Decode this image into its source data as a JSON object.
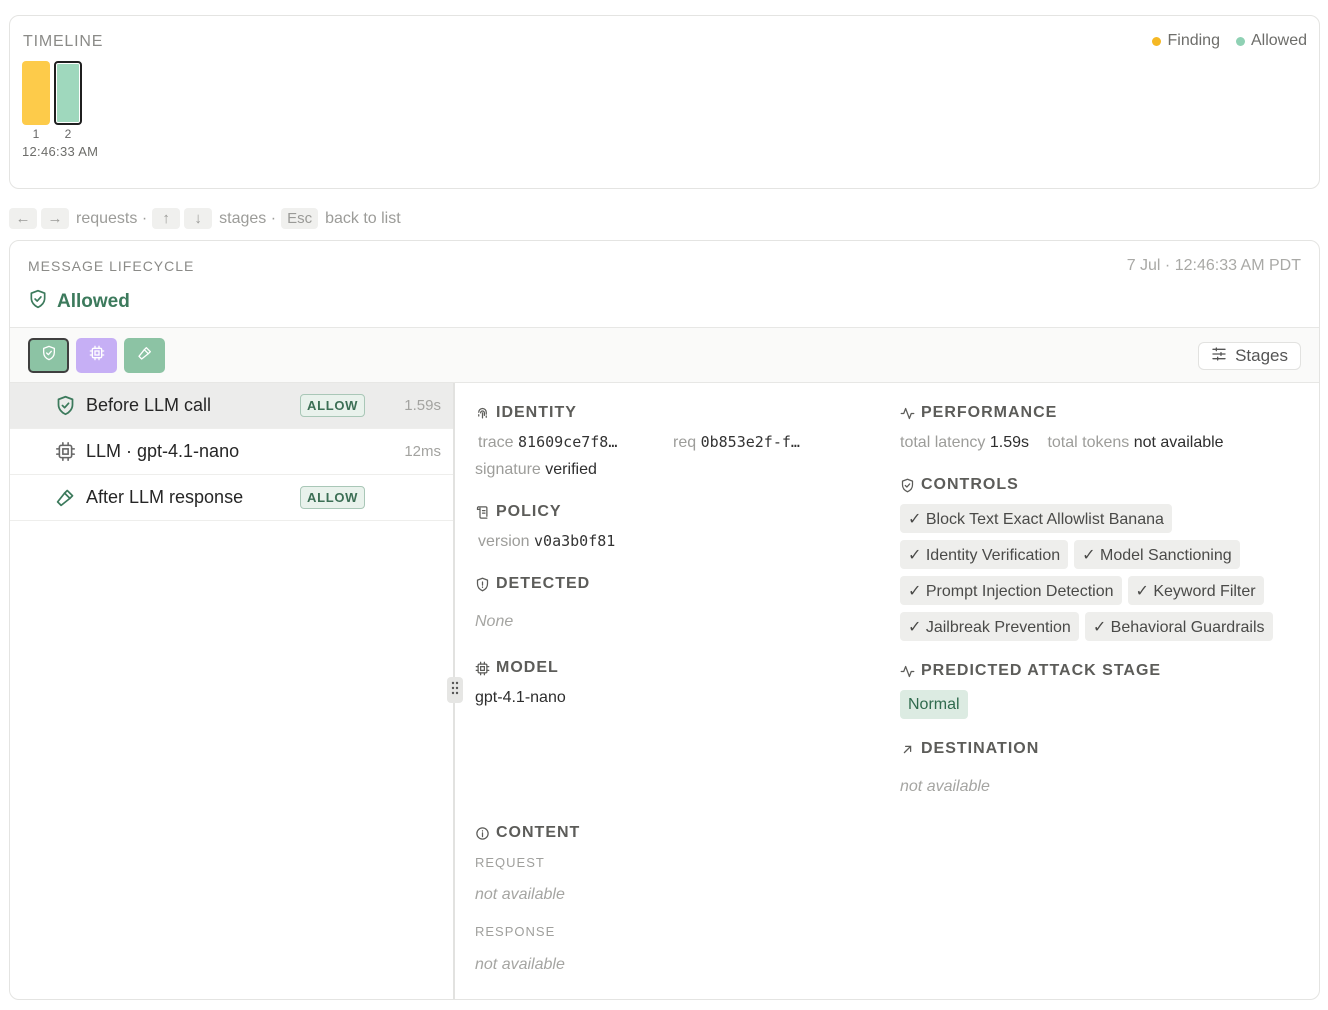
{
  "timeline": {
    "title": "TIMELINE",
    "legend": [
      {
        "label": "Finding",
        "color": "#f5b824"
      },
      {
        "label": "Allowed",
        "color": "#8fd1b4"
      }
    ],
    "bars": [
      {
        "label": "1",
        "color": "#fdcb4a",
        "status": "Finding",
        "selected": false
      },
      {
        "label": "2",
        "color": "#9fd8bd",
        "status": "Allowed",
        "selected": true
      }
    ],
    "time": "12:46:33 AM"
  },
  "hints": {
    "left_key": "←",
    "right_key": "→",
    "requests_label": "requests ·",
    "up_key": "↑",
    "down_key": "↓",
    "stages_label": "stages ·",
    "esc_key": "Esc",
    "back_label": "back to list"
  },
  "lifecycle": {
    "title": "MESSAGE LIFECYCLE",
    "timestamp": "7 Jul · 12:46:33 AM PDT",
    "status": "Allowed",
    "status_color": "#3c7a5c",
    "toolbar": {
      "stage_buttons": [
        {
          "icon": "shield-check-icon",
          "color": "#8cc3a4",
          "selected": true
        },
        {
          "icon": "chip-icon",
          "color": "#c6aff5",
          "selected": false
        },
        {
          "icon": "hammer-icon",
          "color": "#8cc3a4",
          "selected": false
        }
      ],
      "stages_label": "Stages"
    },
    "stages": [
      {
        "name": "Before LLM call",
        "badge": "ALLOW",
        "duration": "1.59s",
        "icon": "shield-check-icon"
      },
      {
        "name": "LLM · gpt-4.1-nano",
        "badge": "",
        "duration": "12ms",
        "icon": "chip-icon"
      },
      {
        "name": "After LLM response",
        "badge": "ALLOW",
        "duration": "",
        "icon": "hammer-icon"
      }
    ]
  },
  "detail": {
    "identity": {
      "title": "IDENTITY",
      "trace_label": "trace",
      "trace_value": "81609ce7f8…",
      "req_label": "req",
      "req_value": "0b853e2f-f…",
      "signature_label": "signature",
      "signature_value": "verified"
    },
    "policy": {
      "title": "POLICY",
      "version_label": "version",
      "version_value": "v0a3b0f81"
    },
    "detected": {
      "title": "DETECTED",
      "value": "None"
    },
    "model": {
      "title": "MODEL",
      "value": "gpt-4.1-nano"
    },
    "content": {
      "title": "CONTENT",
      "request_label": "REQUEST",
      "request_value": "not available",
      "response_label": "RESPONSE",
      "response_value": "not available"
    },
    "performance": {
      "title": "PERFORMANCE",
      "latency_label": "total latency",
      "latency_value": "1.59s",
      "tokens_label": "total tokens",
      "tokens_value": "not available"
    },
    "controls": {
      "title": "CONTROLS",
      "rows": [
        [
          "✓ Block Text Exact Allowlist Banana"
        ],
        [
          "✓ Identity Verification",
          "✓ Model Sanctioning"
        ],
        [
          "✓ Prompt Injection Detection",
          "✓ Keyword Filter"
        ],
        [
          "✓ Jailbreak Prevention",
          "✓ Behavioral Guardrails"
        ]
      ]
    },
    "attack_stage": {
      "title": "PREDICTED ATTACK STAGE",
      "value": "Normal"
    },
    "destination": {
      "title": "DESTINATION",
      "value": "not available"
    }
  }
}
